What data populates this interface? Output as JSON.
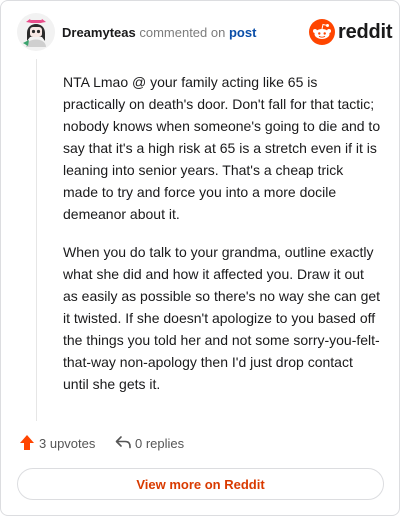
{
  "header": {
    "username": "Dreamyteas",
    "commented_text": "commented on",
    "post_link": "post",
    "brand": "reddit"
  },
  "comment": {
    "paragraphs": [
      "NTA Lmao @ your family acting like 65 is practically on death's door. Don't fall for that tactic; nobody knows when someone's going to die and to say that it's a high risk at 65 is a stretch even if it is leaning into senior years. That's a cheap trick made to try and force you into a more docile demeanor about it.",
      "When you do talk to your grandma, outline exactly what she did and how it affected you. Draw it out as easily as possible so there's no way she can get it twisted. If she doesn't apologize to you based off the things you told her and not some sorry-you-felt-that-way non-apology then I'd just drop contact until she gets it."
    ]
  },
  "actions": {
    "upvotes": "3 upvotes",
    "replies": "0 replies"
  },
  "footer": {
    "view_more": "View more on Reddit"
  },
  "colors": {
    "accent": "#d93a00",
    "upvote": "#ff4500",
    "link": "#0a4ea8",
    "border": "#dcdde0"
  }
}
